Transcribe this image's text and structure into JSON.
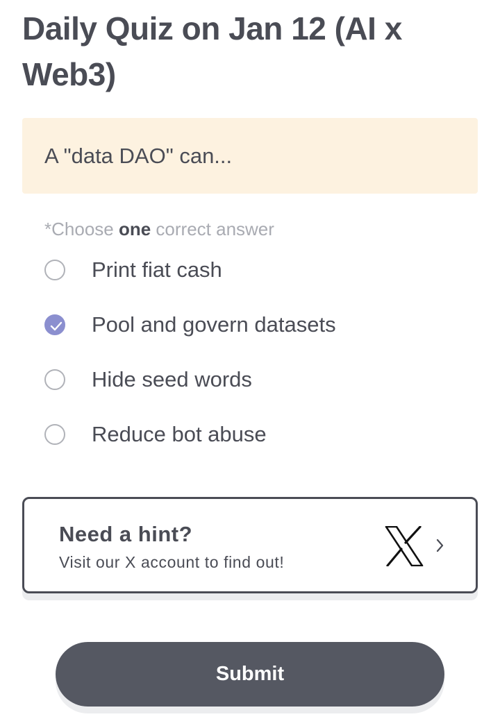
{
  "quiz": {
    "title": "Daily Quiz on Jan 12 (AI x Web3)",
    "question": "A \"data DAO\" can...",
    "instruction": {
      "prefix": "*Choose ",
      "emphasis": "one",
      "suffix": " correct answer"
    },
    "options": [
      {
        "label": "Print fiat cash",
        "selected": false
      },
      {
        "label": "Pool and govern datasets",
        "selected": true
      },
      {
        "label": "Hide seed words",
        "selected": false
      },
      {
        "label": "Reduce bot abuse",
        "selected": false
      }
    ]
  },
  "hint": {
    "title": "Need a hint?",
    "subtitle": "Visit our X account to find out!",
    "icon": "x-logo-icon",
    "chevron_icon": "chevron-right-icon"
  },
  "submit": {
    "label": "Submit"
  },
  "colors": {
    "text": "#4a4c55",
    "question_background": "#fdf2e0",
    "selected_radio": "#8b8fcf",
    "submit_background": "#555862",
    "muted_text": "#a9abb2"
  }
}
